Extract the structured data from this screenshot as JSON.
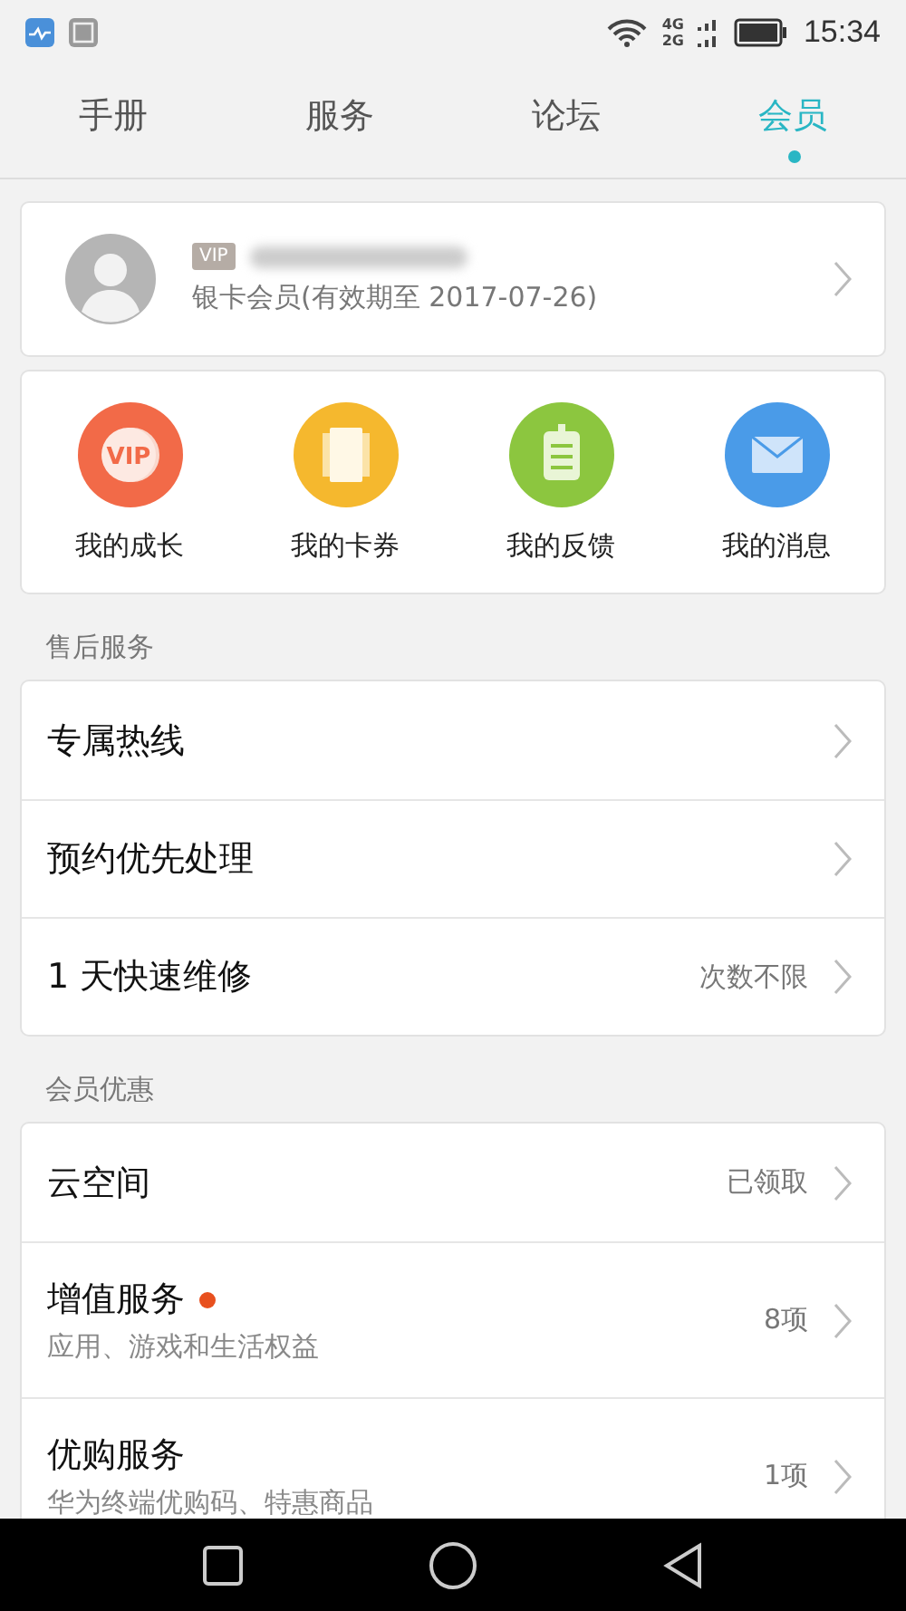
{
  "status_bar": {
    "networks": [
      "4G",
      "2G"
    ],
    "time": "15:34"
  },
  "tabs": [
    {
      "label": "手册",
      "selected": false
    },
    {
      "label": "服务",
      "selected": false
    },
    {
      "label": "论坛",
      "selected": false
    },
    {
      "label": "会员",
      "selected": true
    }
  ],
  "profile": {
    "badge": "VIP",
    "membership": "银卡会员(有效期至 2017-07-26)"
  },
  "shortcuts": [
    {
      "kind": "growth",
      "label": "我的成长",
      "icon_text": "VIP"
    },
    {
      "kind": "coupons",
      "label": "我的卡券"
    },
    {
      "kind": "feedback",
      "label": "我的反馈"
    },
    {
      "kind": "messages",
      "label": "我的消息"
    }
  ],
  "sections": [
    {
      "title": "售后服务",
      "rows": [
        {
          "title": "专属热线"
        },
        {
          "title": "预约优先处理"
        },
        {
          "title": "1 天快速维修",
          "value": "次数不限"
        }
      ]
    },
    {
      "title": "会员优惠",
      "rows": [
        {
          "title": "云空间",
          "value": "已领取"
        },
        {
          "title": "增值服务",
          "subtitle": "应用、游戏和生活权益",
          "value": "8项",
          "new": true
        },
        {
          "title": "优购服务",
          "subtitle": "华为终端优购码、特惠商品",
          "value": "1项"
        }
      ]
    }
  ]
}
